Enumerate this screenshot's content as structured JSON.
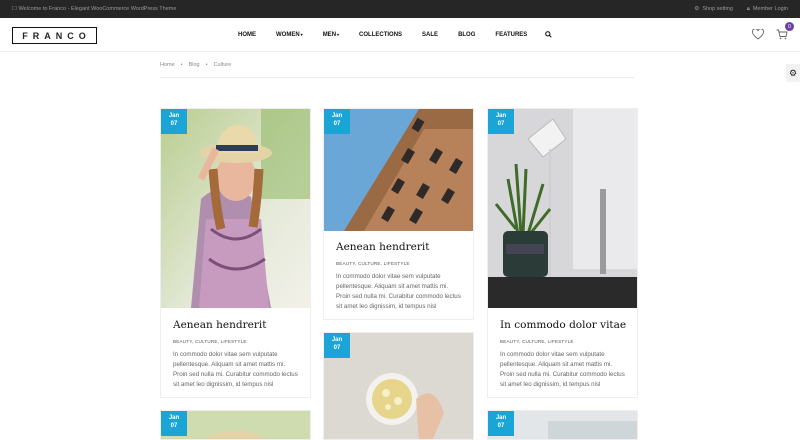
{
  "topbar": {
    "welcome": "Welcome to Franco - Elegant WooCommerce WordPress Theme",
    "shop_setting": "Shop setting",
    "member_login": "Member Login"
  },
  "header": {
    "logo": "FRANCO",
    "nav": [
      "HOME",
      "WOMEN",
      "MEN",
      "COLLECTIONS",
      "SALE",
      "BLOG",
      "FEATURES"
    ],
    "cart_count": "0"
  },
  "breadcrumb": [
    "Home",
    "Blog",
    "Culture"
  ],
  "posts": [
    {
      "month": "Jan",
      "day": "07",
      "title": "Aenean hendrerit",
      "categories": "BEAUTY, CULTURE, LIFESTYLE",
      "excerpt": "In commodo dolor vitae sem vulputate pellentesque. Aliquam sit amet mattis mi. Proin sed nulla mi. Curabitur commodo lectus sit amet leo dignissim, id tempus nisl"
    },
    {
      "month": "Jan",
      "day": "07",
      "title": "Aenean hendrerit",
      "categories": "BEAUTY, CULTURE, LIFESTYLE",
      "excerpt": "In commodo dolor vitae sem vulputate pellentesque. Aliquam sit amet mattis mi. Proin sed nulla mi. Curabitur commodo lectus sit amet leo dignissim, id tempus nisl"
    },
    {
      "month": "Jan",
      "day": "07",
      "title": "In commodo dolor vitae",
      "categories": "BEAUTY, CULTURE, LIFESTYLE",
      "excerpt": "In commodo dolor vitae sem vulputate pellentesque. Aliquam sit amet mattis mi. Proin sed nulla mi. Curabitur commodo lectus sit amet leo dignissim, id tempus nisl"
    },
    {
      "month": "Jan",
      "day": "07"
    },
    {
      "month": "Jan",
      "day": "07"
    },
    {
      "month": "Jan",
      "day": "07"
    }
  ]
}
